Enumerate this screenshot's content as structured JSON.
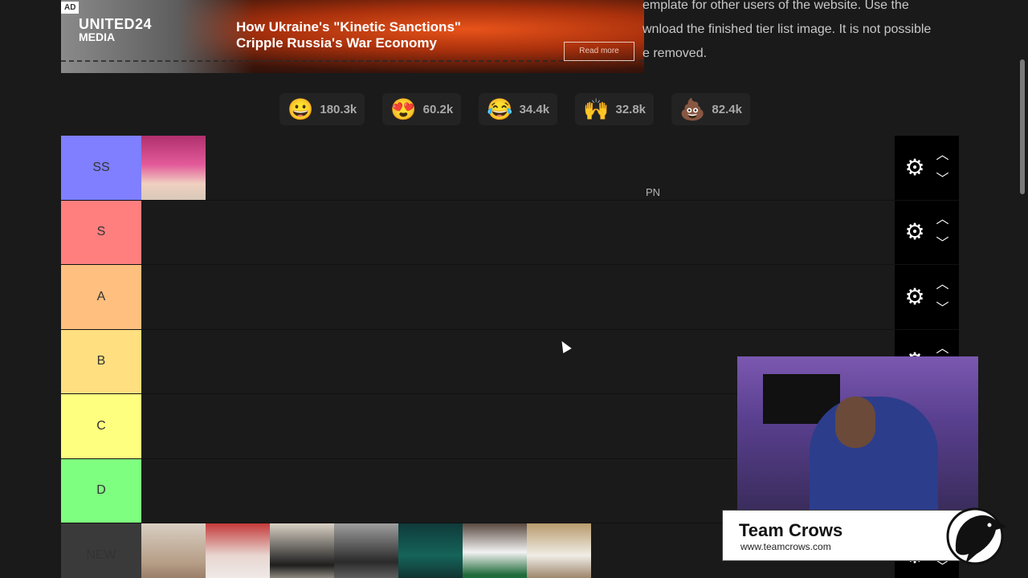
{
  "ad": {
    "tag": "AD",
    "brand_line1": "UNITED24",
    "brand_line2": "MEDIA",
    "headline": "How Ukraine's \"Kinetic Sanctions\" Cripple Russia's War Economy",
    "cta": "Read more"
  },
  "intro_lines": [
    "emplate for other users of the website. Use the",
    "wnload the finished tier list image. It is not possible",
    "e removed."
  ],
  "reactions": [
    {
      "emoji": "😀",
      "count": "180.3k"
    },
    {
      "emoji": "😍",
      "count": "60.2k"
    },
    {
      "emoji": "😂",
      "count": "34.4k"
    },
    {
      "emoji": "🙌",
      "count": "32.8k"
    },
    {
      "emoji": "💩",
      "count": "82.4k"
    }
  ],
  "tiers": [
    {
      "label": "SS",
      "color": "#7f7fff"
    },
    {
      "label": "S",
      "color": "#ff7f7f"
    },
    {
      "label": "A",
      "color": "#ffbf7f"
    },
    {
      "label": "B",
      "color": "#ffdf7f"
    },
    {
      "label": "C",
      "color": "#ffff7f"
    },
    {
      "label": "D",
      "color": "#7fff7f"
    },
    {
      "label": "NEW",
      "color": "#3a3a3a"
    }
  ],
  "floating_label": "PN",
  "team": {
    "name": "Team Crows",
    "url": "www.teamcrows.com"
  }
}
